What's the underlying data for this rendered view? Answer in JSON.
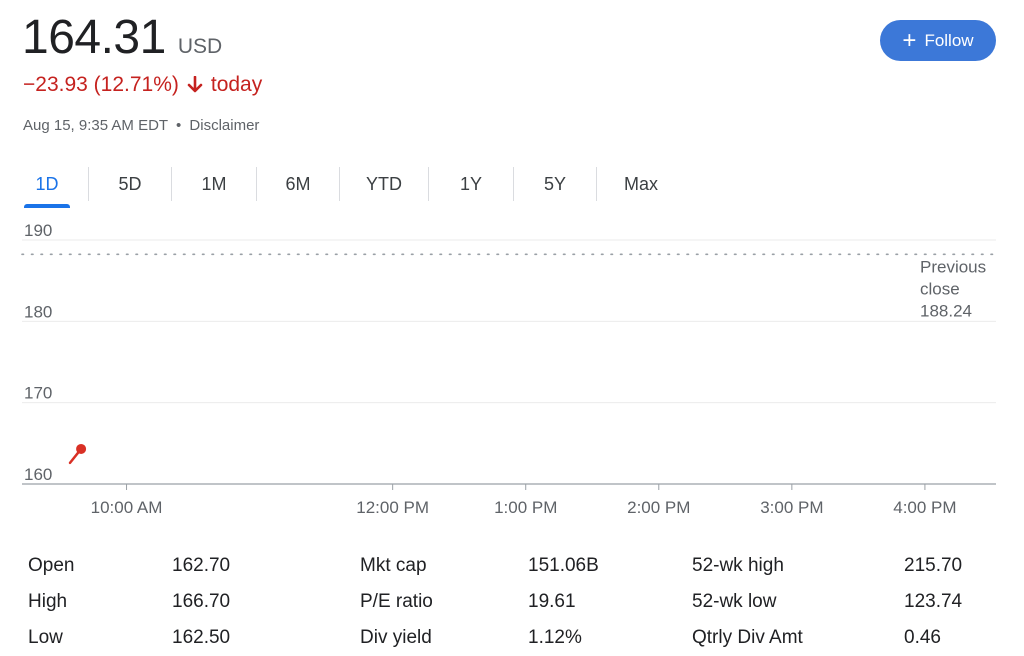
{
  "quote": {
    "price": "164.31",
    "currency": "USD",
    "change": "−23.93 (12.71%)",
    "change_direction_word": "today",
    "timestamp": "Aug 15, 9:35 AM EDT",
    "separator": "•",
    "disclaimer": "Disclaimer",
    "down_color": "#c5221f"
  },
  "follow_button": {
    "icon": "plus-icon",
    "label": "Follow",
    "color": "#3c78d8"
  },
  "tabs": {
    "active": "1D",
    "items": [
      "1D",
      "5D",
      "1M",
      "6M",
      "YTD",
      "1Y",
      "5Y",
      "Max"
    ]
  },
  "chart_data": {
    "type": "line",
    "ylim": [
      160,
      190
    ],
    "y_ticks": [
      190,
      180,
      170,
      160
    ],
    "x_ticks": [
      "10:00 AM",
      "12:00 PM",
      "1:00 PM",
      "2:00 PM",
      "3:00 PM",
      "4:00 PM"
    ],
    "x_range_minutes": [
      570,
      965
    ],
    "x_tick_minutes": [
      600,
      720,
      780,
      840,
      900,
      960
    ],
    "series": [
      {
        "color": "#d93025",
        "points": [
          [
            570,
            162.6
          ],
          [
            575,
            164.31
          ]
        ]
      }
    ],
    "reference_line": {
      "label_lines": [
        "Previous",
        "close",
        "188.24"
      ],
      "value": 188.24
    },
    "grid": true
  },
  "stats": {
    "rows": [
      [
        {
          "label": "Open",
          "value": "162.70"
        },
        {
          "label": "Mkt cap",
          "value": "151.06B"
        },
        {
          "label": "52-wk high",
          "value": "215.70"
        }
      ],
      [
        {
          "label": "High",
          "value": "166.70"
        },
        {
          "label": "P/E ratio",
          "value": "19.61"
        },
        {
          "label": "52-wk low",
          "value": "123.74"
        }
      ],
      [
        {
          "label": "Low",
          "value": "162.50"
        },
        {
          "label": "Div yield",
          "value": "1.12%"
        },
        {
          "label": "Qtrly Div Amt",
          "value": "0.46"
        }
      ]
    ]
  }
}
